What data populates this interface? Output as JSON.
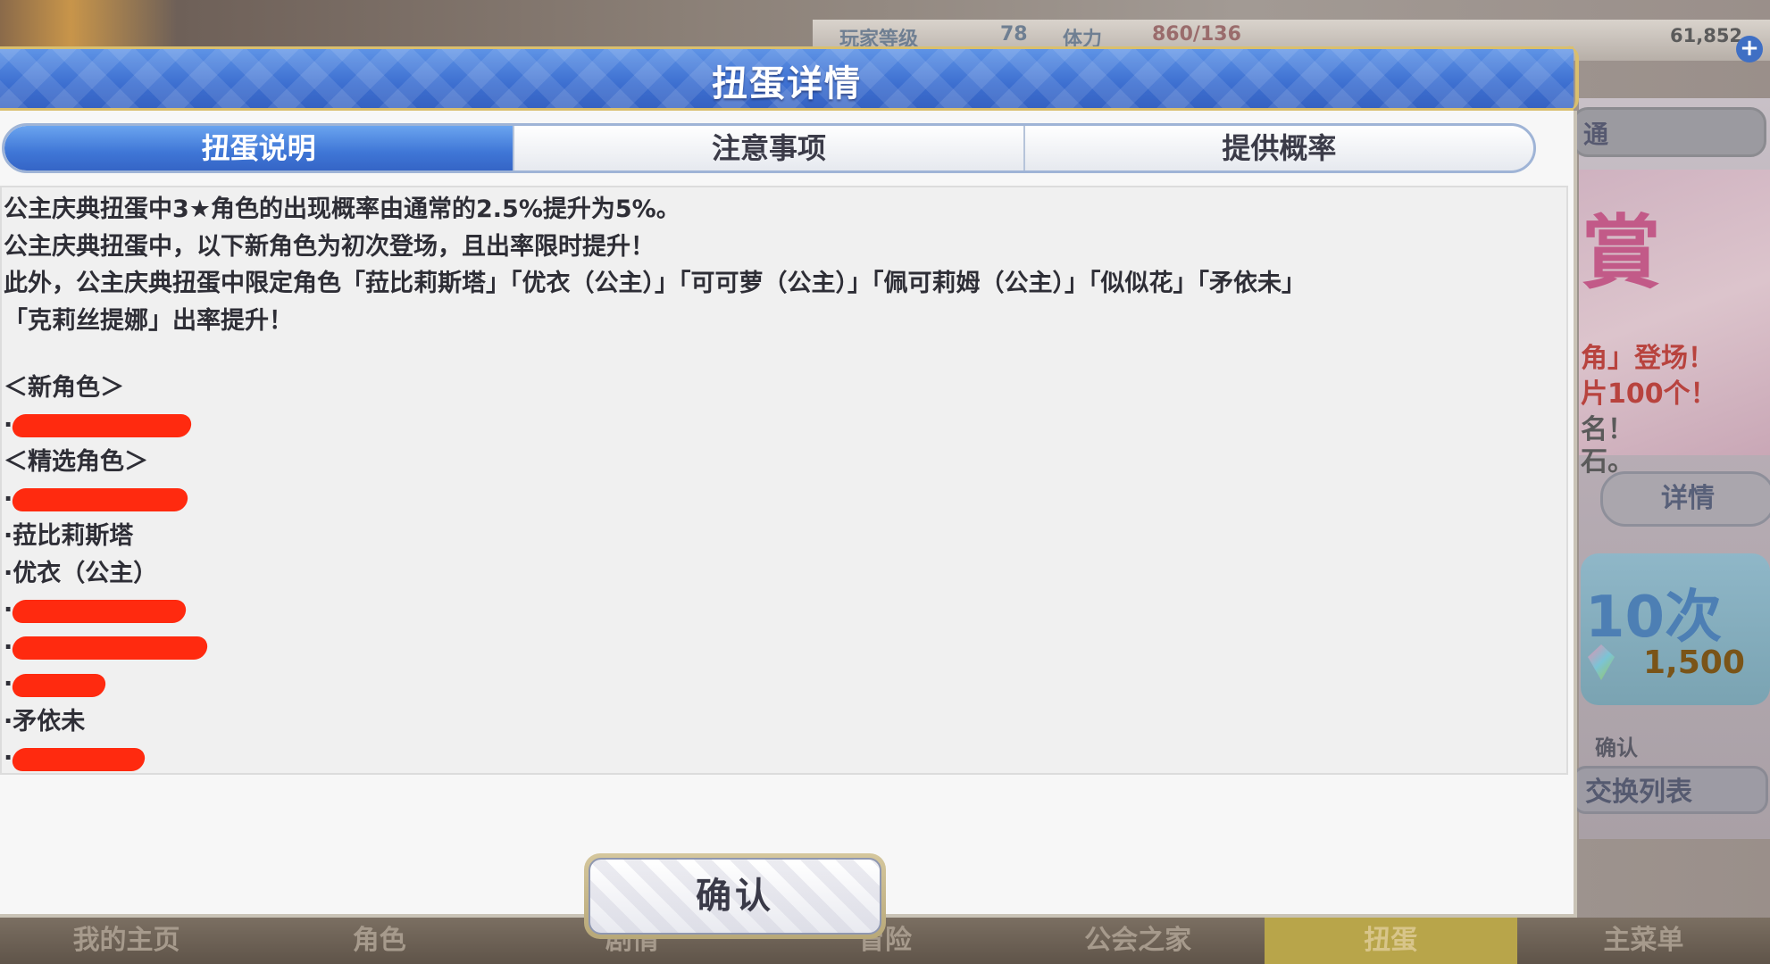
{
  "background": {
    "hud": [
      "玩家等级",
      "78",
      "体力",
      "860/136"
    ],
    "gem_count": "61,852",
    "plus_label": "+",
    "side_button_top": "通",
    "banner_kanji": "賞",
    "banner_lines": [
      "角」登场！",
      "片100个！",
      "名！",
      "石。"
    ],
    "detail_button": "详情",
    "ten_pull_label": "10次",
    "ten_pull_cost": "1,500",
    "side_small": "确认",
    "exchange_button": "交换列表",
    "nav": [
      "我的主页",
      "角色",
      "剧情",
      "冒险",
      "公会之家",
      "扭蛋",
      "主菜单"
    ],
    "nav_active": 5
  },
  "dialog": {
    "title": "扭蛋详情",
    "tabs": [
      "扭蛋说明",
      "注意事项",
      "提供概率"
    ],
    "active_tab": 0,
    "content": {
      "line1": "公主庆典扭蛋中3★角色的出现概率由通常的2.5%提升为5%。",
      "line2": "公主庆典扭蛋中，以下新角色为初次登场，且出率限时提升！",
      "line3": "此外，公主庆典扭蛋中限定角色「菈比莉斯塔」「优衣（公主）」「可可萝（公主）」「佩可莉姆（公主）」「似似花」「矛依未」",
      "line4": "「克莉丝提娜」出率提升！",
      "new_header": "＜新角色＞",
      "featured_header": "＜精选角色＞",
      "item_rabirista": "·菈比莉斯塔",
      "item_yui": "·优衣（公主）",
      "item_muimi": "·矛依未",
      "bullet": "·"
    },
    "confirm_label": "确认"
  }
}
